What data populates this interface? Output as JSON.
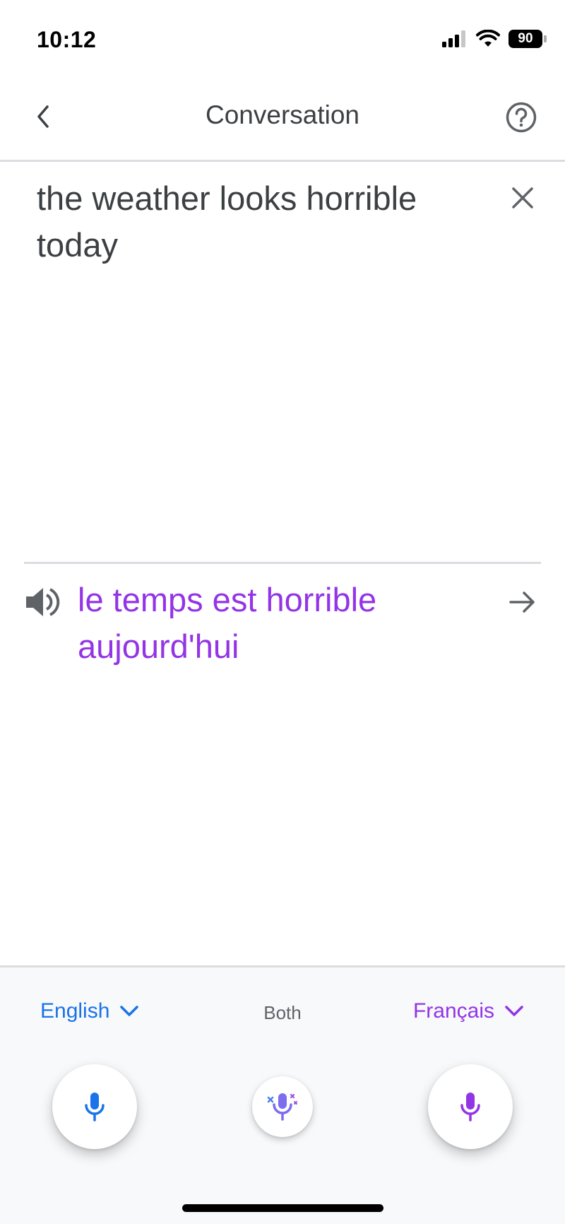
{
  "status_bar": {
    "time": "10:12",
    "battery": "90"
  },
  "header": {
    "title": "Conversation",
    "icons": {
      "back": "chevron-left-icon",
      "help": "help-circle-icon"
    }
  },
  "source": {
    "text": "the weather looks horrible today",
    "clear_icon": "close-icon"
  },
  "translation": {
    "text": "le temps est horrible aujourd'hui",
    "speaker_icon": "speaker-icon",
    "forward_icon": "arrow-right-icon"
  },
  "languages": {
    "left": "English",
    "center": "Both",
    "right": "Français"
  },
  "colors": {
    "english_accent": "#1a73e8",
    "french_accent": "#9334e6",
    "text": "#3c4043",
    "divider": "#dadce0"
  }
}
